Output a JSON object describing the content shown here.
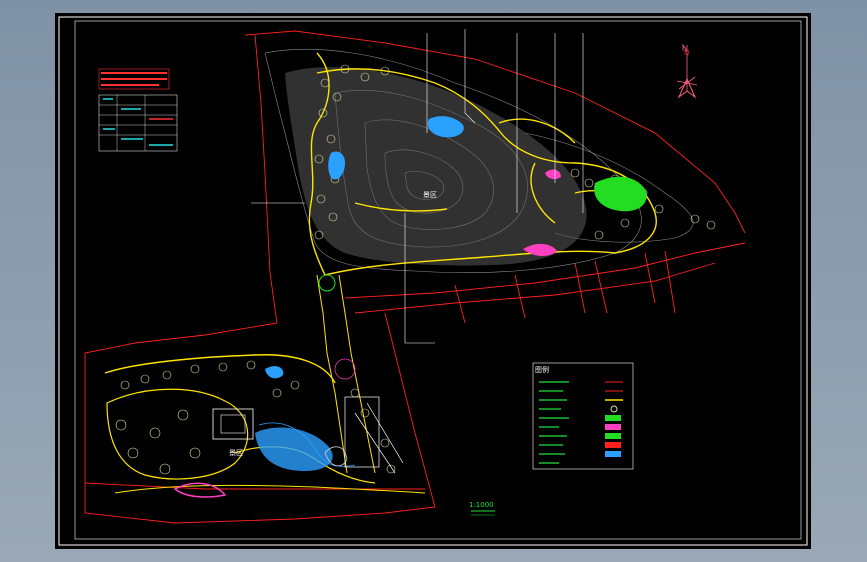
{
  "drawing": {
    "district_label_upper": "景区",
    "district_label_lower": "景区",
    "legend_title": "图例",
    "scale_label": "1:1000",
    "north_label": "N"
  },
  "colors": {
    "paper": "#000000",
    "frame": "#ffffff",
    "path": "#ffe400",
    "contour": "#8c8c8c",
    "boundary": "#ff2020",
    "water": "#2aa0ff",
    "lawn": "#22dd22",
    "flower": "#ff40c0",
    "tree": "#e0e0a0"
  },
  "legend_items": [
    {
      "symbol": "boundary-line-icon"
    },
    {
      "symbol": "road-line-icon"
    },
    {
      "symbol": "path-line-icon"
    },
    {
      "symbol": "tree-circle-icon"
    },
    {
      "symbol": "shrub-icon"
    },
    {
      "symbol": "lawn-hatch-icon"
    },
    {
      "symbol": "flower-bed-icon"
    },
    {
      "symbol": "flower-bed-icon"
    },
    {
      "symbol": "water-hatch-icon"
    },
    {
      "symbol": "lamp-icon"
    },
    {
      "symbol": "bench-icon"
    }
  ]
}
